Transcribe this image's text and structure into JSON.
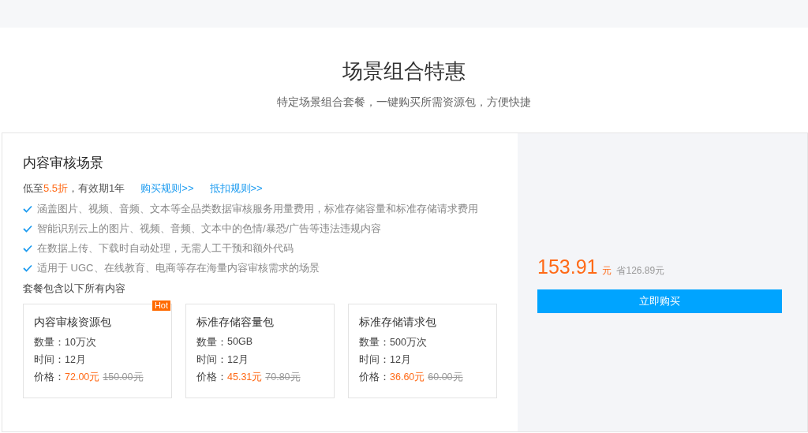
{
  "header": {
    "title": "场景组合特惠",
    "subtitle": "特定场景组合套餐，一键购买所需资源包，方便快捷"
  },
  "scenario": {
    "title": "内容审核场景",
    "discount": {
      "prefix": "低至",
      "highlight": "5.5折",
      "suffix": "，有效期1年"
    },
    "links": [
      "购买规则>>",
      "抵扣规则>>"
    ],
    "features": [
      "涵盖图片、视频、音频、文本等全品类数据审核服务用量费用，标准存储容量和标准存储请求费用",
      "智能识别云上的图片、视频、音频、文本中的色情/暴恐/广告等违法违规内容",
      "在数据上传、下载时自动处理，无需人工干预和额外代码",
      "适用于 UGC、在线教育、电商等存在海量内容审核需求的场景"
    ],
    "packages_label": "套餐包含以下所有内容",
    "packages": [
      {
        "name": "内容审核资源包",
        "badge": "Hot",
        "rows": [
          {
            "label": "数量：",
            "value": "10万次"
          },
          {
            "label": "时间：",
            "value": "12月"
          }
        ],
        "price_label": "价格：",
        "price": "72.00元",
        "original_price": "150.00元"
      },
      {
        "name": "标准存储容量包",
        "rows": [
          {
            "label": "数量：",
            "value": "50GB"
          },
          {
            "label": "时间：",
            "value": "12月"
          }
        ],
        "price_label": "价格：",
        "price": "45.31元",
        "original_price": "70.80元"
      },
      {
        "name": "标准存储请求包",
        "rows": [
          {
            "label": "数量：",
            "value": "500万次"
          },
          {
            "label": "时间：",
            "value": "12月"
          }
        ],
        "price_label": "价格：",
        "price": "36.60元",
        "original_price": "60.00元"
      }
    ]
  },
  "purchase": {
    "price": "153.91",
    "unit": "元",
    "savings": "省126.89元",
    "button": "立即购买"
  }
}
